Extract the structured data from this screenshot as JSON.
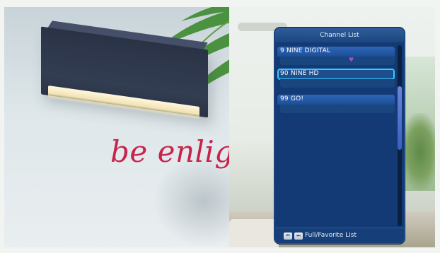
{
  "osd": {
    "title": "Channel List",
    "channels": [
      {
        "label": "9  NINE DIGITAL",
        "favorite": true
      },
      {
        "label": "90  NINE HD",
        "selected": true
      },
      {
        "label": "99  GO!"
      }
    ],
    "footer": {
      "keys": [
        "⏮",
        "⏭"
      ],
      "label": "Full/Favorite List"
    },
    "scroll_position": 0.35
  },
  "background": {
    "tagline": "be enlighten"
  },
  "colors": {
    "osd_panel": "#133a74",
    "row_bar": "#2e66b6",
    "selection_border": "#39c7ff",
    "favorite_heart": "#b24ad8",
    "tagline": "#c8234b"
  },
  "icons": {
    "favorite": "heart-icon",
    "prev_key": "skip-back-icon",
    "next_key": "skip-forward-icon"
  }
}
